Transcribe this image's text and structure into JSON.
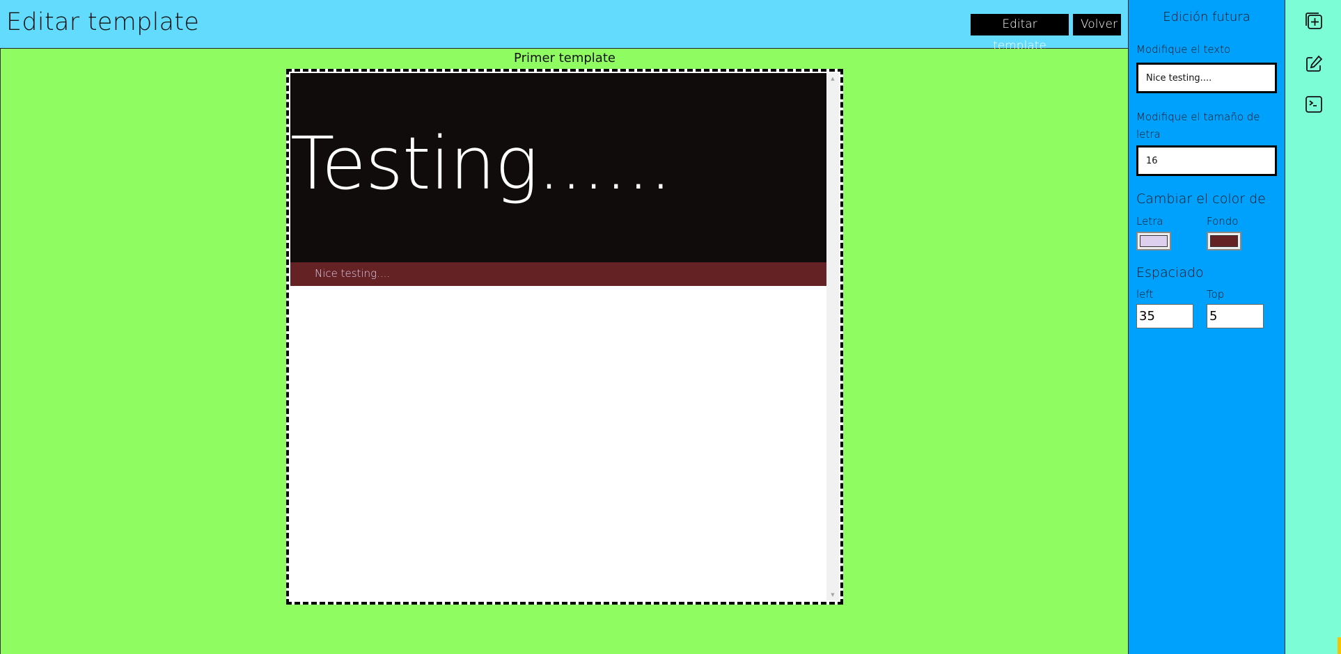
{
  "header": {
    "title": "Editar template",
    "edit_button": "Editar template",
    "back_button": "Volver"
  },
  "canvas": {
    "template_name": "Primer template",
    "preview": {
      "hero_text": "Testing......",
      "bar_text": "Nice testing....",
      "hero_bg": "#100c0c",
      "bar_bg": "#652224",
      "bar_text_color": "#dcd0ee"
    }
  },
  "panel": {
    "title": "Edición futura",
    "text_label": "Modifique el texto",
    "text_value": "Nice testing....",
    "size_label": "Modifique el tamaño de letra",
    "size_value": "16",
    "color_heading": "Cambiar el color de",
    "color_font_label": "Letra",
    "color_font_value": "#dcd0ee",
    "color_bg_label": "Fondo",
    "color_bg_value": "#652224",
    "spacing_heading": "Espaciado",
    "spacing_left_label": "left",
    "spacing_left_value": "35",
    "spacing_top_label": "Top",
    "spacing_top_value": "5"
  },
  "rail": {
    "icons": [
      "add-template-icon",
      "edit-icon",
      "terminal-icon"
    ]
  },
  "colors": {
    "header_bg": "#62dbfd",
    "canvas_bg": "#8ffd62",
    "panel_bg": "#00a1fd",
    "rail_bg": "#7dfdd5"
  }
}
